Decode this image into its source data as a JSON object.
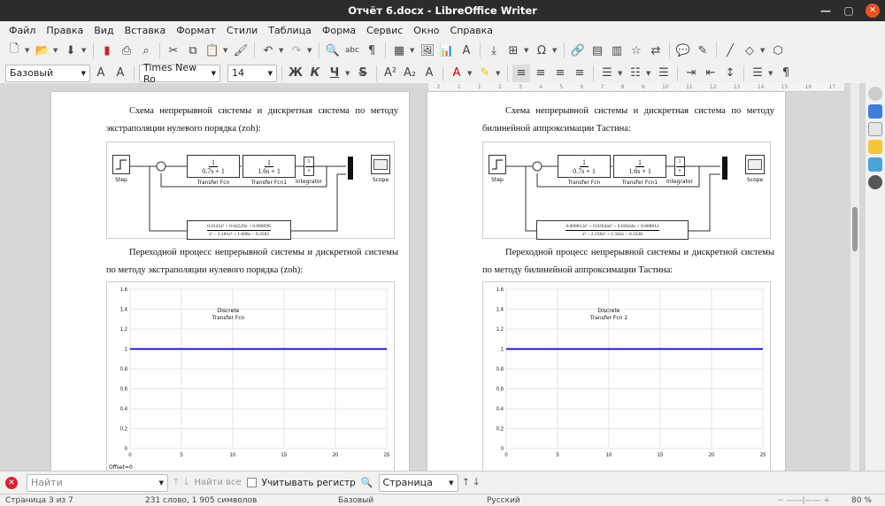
{
  "window": {
    "title": "Отчёт 6.docx - LibreOffice Writer"
  },
  "menu": [
    "Файл",
    "Правка",
    "Вид",
    "Вставка",
    "Формат",
    "Стили",
    "Таблица",
    "Форма",
    "Сервис",
    "Окно",
    "Справка"
  ],
  "format": {
    "style": "Базовый",
    "font": "Times New Ro",
    "size": "14"
  },
  "left_page": {
    "para1": "Схема непрерывной системы и дискретная система по методу экстраполяции нулевого порядка (zoh):",
    "para2": "Переходной процесс непрерывной системы и дискретной системы по методу экстраполяции нулевого порядка (zoh):",
    "blocks": {
      "step": "Step",
      "tf1_num": "1",
      "tf1_den": "0.7s + 1",
      "tf1_label": "Transfer Fcn",
      "tf2_num": "1",
      "tf2_den": "1.6s + 1",
      "tf2_label": "Transfer Fcn1",
      "int_num": "1",
      "int_den": "s",
      "int_label": "Integrator",
      "scope": "Scope",
      "disc_num": "0.0145z³ + 0.04529z + 0.008696",
      "disc_den": "z³ − 2.181z² + 1.608z − 0.3582",
      "disc_label1": "Discrete",
      "disc_label2": "Transfer Fcn"
    },
    "plot_footer": "Offset=0"
  },
  "right_page": {
    "para1": "Схема непрерывной системы и дискретная система по методу билинейной аппроксимации Тастина:",
    "para2": "Переходной процесс непрерывной системы и дискретной системы по методу билинейной аппроксимации Тастина:",
    "blocks": {
      "step": "Step",
      "tf1_num": "1",
      "tf1_den": "0.7s + 1",
      "tf1_label": "Transfer Fcn",
      "tf2_num": "1",
      "tf2_den": "1.6s + 1",
      "tf2_label": "Transfer Fcn1",
      "int_num": "1",
      "int_den": "s",
      "int_label": "Integrator",
      "scope": "Scope",
      "disc_num": "0.008812z³ + 0.02644z² + 0.02644z + 0.008812",
      "disc_den": "z³ − 2.158z² + 1.562z − 0.3338",
      "disc_label1": "Discrete",
      "disc_label2": "Transfer Fcn 2"
    }
  },
  "chart_data": [
    {
      "type": "line",
      "xlim": [
        0,
        25
      ],
      "ylim": [
        0,
        1.6
      ],
      "xticks": [
        "0",
        "5",
        "10",
        "15",
        "20",
        "25"
      ],
      "yticks": [
        "0",
        "0.2",
        "0.4",
        "0.6",
        "0.8",
        "1",
        "1.2",
        "1.4",
        "1.6"
      ],
      "series": [
        {
          "color": "#0000cc",
          "x": [
            0,
            25
          ],
          "y": [
            1,
            1
          ]
        }
      ],
      "grid": true
    },
    {
      "type": "line",
      "xlim": [
        0,
        25
      ],
      "ylim": [
        0,
        1.6
      ],
      "xticks": [
        "0",
        "5",
        "10",
        "15",
        "20",
        "25"
      ],
      "yticks": [
        "0",
        "0.2",
        "0.4",
        "0.6",
        "0.8",
        "1",
        "1.2",
        "1.4",
        "1.6"
      ],
      "series": [
        {
          "color": "#0000cc",
          "x": [
            0,
            25
          ],
          "y": [
            1,
            1
          ]
        }
      ],
      "grid": true
    }
  ],
  "findbar": {
    "placeholder": "Найти",
    "find_all": "Найти все",
    "match_case": "Учитывать регистр",
    "page_combo": "Страница"
  },
  "status": {
    "page": "Страница 3 из 7",
    "words": "231 слово, 1 905 символов",
    "style": "Базовый",
    "lang": "Русский",
    "zoom": "80 %"
  }
}
